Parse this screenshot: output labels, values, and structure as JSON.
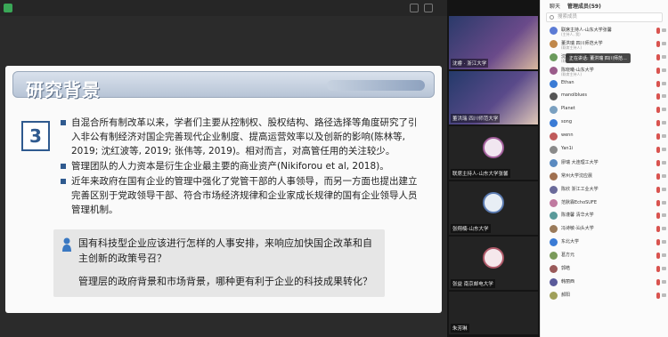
{
  "slide": {
    "title": "研究背景",
    "number": "3",
    "bullets": [
      "自混合所有制改革以来，学者们主要从控制权、股权结构、路径选择等角度研究了引入非公有制经济对国企完善现代企业制度、提高运营效率以及创新的影响(陈林等, 2019; 沈红波等, 2019; 张伟等, 2019)。相对而言，对高管任用的关注较少。",
      "管理团队的人力资本是衍生企业最主要的商业资产(Nikiforou et al, 2018)。",
      "近年来政府在国有企业的管理中强化了党管干部的人事领导，而另一方面也提出建立完善区别于党政领导干部、符合市场经济规律和企业家成长规律的国有企业领导人员管理机制。"
    ],
    "question1": "国有科技型企业应该进行怎样的人事安排，来响应加快国企改革和自主创新的政策号召？",
    "question2": "管理层的政府背景和市场背景，哪种更有利于企业的科技成果转化？"
  },
  "videos": [
    {
      "name": "沈睿 · 浙江大学"
    },
    {
      "name": "董洪瑞 四川师范大学"
    },
    {
      "name": "联席主持人-山东大学张馨"
    },
    {
      "name": "张翔楠-山东大学"
    },
    {
      "name": "张益 南京邮电大学"
    },
    {
      "name": "朱芳琳"
    }
  ],
  "panel": {
    "tab_chat": "聊天",
    "tab_members": "管理成员(59)",
    "search_placeholder": "搜索成员",
    "tooltip": "正在讲话: 董洪瑞 四川师范…",
    "members": [
      {
        "name": "联席主持人-山东大学张馨",
        "sub": "(主持人, 我)",
        "color": "#5b7bd5"
      },
      {
        "name": "董洪瑞 四川师范大学",
        "sub": "(联席主持人)",
        "color": "#c0874a"
      },
      {
        "name": "沈睿-浙江大学",
        "sub": "(联席主持人)",
        "color": "#6a9a5b"
      },
      {
        "name": "陈晓曦-山东大学",
        "sub": "(联席主持人)",
        "color": "#9a5b8a"
      },
      {
        "name": "Ethan",
        "sub": "",
        "color": "#3a7bd5"
      },
      {
        "name": "manolblues",
        "sub": "",
        "color": "#555"
      },
      {
        "name": "Planet",
        "sub": "",
        "color": "#7aa0c0"
      },
      {
        "name": "song",
        "sub": "",
        "color": "#3a7bd5"
      },
      {
        "name": "wenn",
        "sub": "",
        "color": "#c05a5a"
      },
      {
        "name": "Yan1i",
        "sub": "",
        "color": "#8a8a8a"
      },
      {
        "name": "廖瑞 大连理工大学",
        "sub": "",
        "color": "#5a8ac0"
      },
      {
        "name": "常州大学沈应晨",
        "sub": "",
        "color": "#a07050"
      },
      {
        "name": "陈欣 浙江工业大学",
        "sub": "",
        "color": "#6a6a9a"
      },
      {
        "name": "范默霖EchoSUFE",
        "sub": "",
        "color": "#c07aa0"
      },
      {
        "name": "陈谨馨 清华大学",
        "sub": "",
        "color": "#5a9a9a"
      },
      {
        "name": "冯诗敏-汕头大学",
        "sub": "",
        "color": "#9a7a5a"
      },
      {
        "name": "东北大学",
        "sub": "",
        "color": "#3a7bd5"
      },
      {
        "name": "葛方元",
        "sub": "",
        "color": "#7a9a5a"
      },
      {
        "name": "郭皓",
        "sub": "",
        "color": "#9a5a5a"
      },
      {
        "name": "韩丽西",
        "sub": "",
        "color": "#5a5a9a"
      },
      {
        "name": "郝阳",
        "sub": "",
        "color": "#a0a05a"
      }
    ]
  }
}
